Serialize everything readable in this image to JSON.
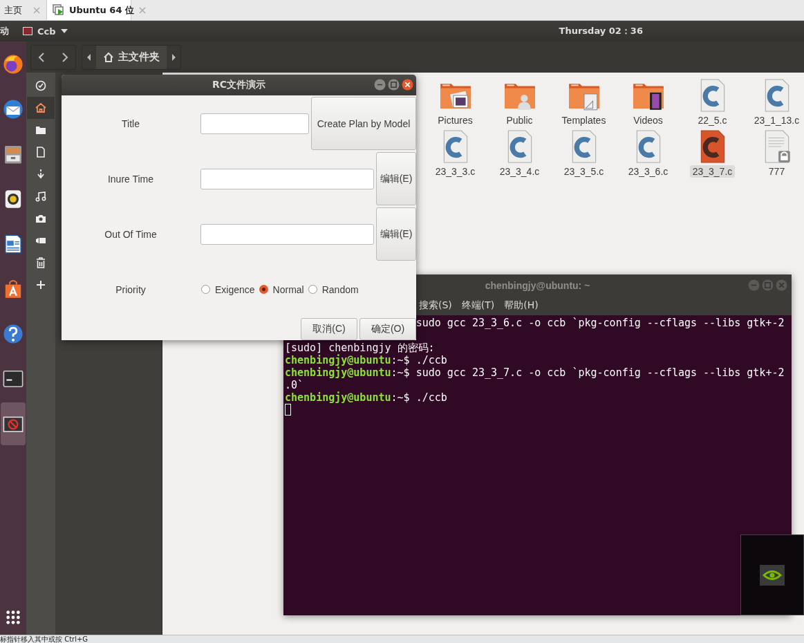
{
  "browser_tabs": [
    {
      "label": "主页",
      "selected": false
    },
    {
      "label": "Ubuntu 64 位",
      "selected": true
    }
  ],
  "top_bar": {
    "activities": "动",
    "app_menu": "Ccb",
    "clock": "Thursday 02：36"
  },
  "dock": {
    "items": [
      {
        "active": false
      },
      {
        "active": false
      },
      {
        "active": false
      },
      {
        "active": false
      },
      {
        "active": false
      },
      {
        "active": false
      },
      {
        "active": false
      },
      {
        "active": false
      },
      {
        "active": true
      }
    ]
  },
  "file_manager": {
    "path": "主文件夹",
    "sidebar": {
      "items": [
        {
          "selected": false
        },
        {
          "selected": true
        },
        {
          "selected": false
        },
        {
          "selected": false
        },
        {
          "selected": false
        },
        {
          "selected": false
        },
        {
          "selected": false
        },
        {
          "selected": false
        },
        {
          "selected": false
        },
        {
          "selected": false
        }
      ]
    },
    "files": [
      {
        "name": "Pictures",
        "kind": "pictures-folder",
        "selected": false
      },
      {
        "name": "Public",
        "kind": "public-folder",
        "selected": false
      },
      {
        "name": "Templates",
        "kind": "templates-folder",
        "selected": false
      },
      {
        "name": "Videos",
        "kind": "videos-folder",
        "selected": false
      },
      {
        "name": "22_5.c",
        "kind": "c-file",
        "selected": false
      },
      {
        "name": "23_1_13.c",
        "kind": "c-file",
        "selected": false
      },
      {
        "name": "23_3_3.c",
        "kind": "c-file",
        "selected": false
      },
      {
        "name": "23_3_4.c",
        "kind": "c-file",
        "selected": false
      },
      {
        "name": "23_3_5.c",
        "kind": "c-file",
        "selected": false
      },
      {
        "name": "23_3_6.c",
        "kind": "c-file",
        "selected": false
      },
      {
        "name": "23_3_7.c",
        "kind": "c-file",
        "selected": true
      },
      {
        "name": "777",
        "kind": "locked-file",
        "selected": false
      }
    ]
  },
  "dialog": {
    "title": "RC文件演示",
    "rows": [
      {
        "label": "Title",
        "button": "Create Plan by Model"
      },
      {
        "label": "Inure Time",
        "button": "编辑(E)"
      },
      {
        "label": "Out Of Time",
        "button": "编辑(E)"
      }
    ],
    "priority": {
      "label": "Priority",
      "options": [
        {
          "label": "Exigence",
          "selected": false
        },
        {
          "label": "Normal",
          "selected": true
        },
        {
          "label": "Random",
          "selected": false
        }
      ]
    },
    "buttons": [
      "取消(C)",
      "确定(O)"
    ]
  },
  "terminal": {
    "title": "chenbingjy@ubuntu: ~",
    "menu": [
      "搜索(S)",
      "终端(T)",
      "帮助(H)"
    ],
    "lines": [
      "sudo gcc 23_3_6.c -o ccb `pkg-config --cflags --libs gtk+-2",
      "[sudo] chenbingjy 的密码:",
      "**chenbingjy@ubuntu**:~$ ./ccb",
      "**chenbingjy@ubuntu**:~$ sudo gcc 23_3_7.c -o ccb `pkg-config --cflags --libs gtk+-2",
      ".0`",
      "**chenbingjy@ubuntu**:~$ ./ccb"
    ]
  },
  "status_bar": "标指针移入其中或按 Ctrl+G"
}
